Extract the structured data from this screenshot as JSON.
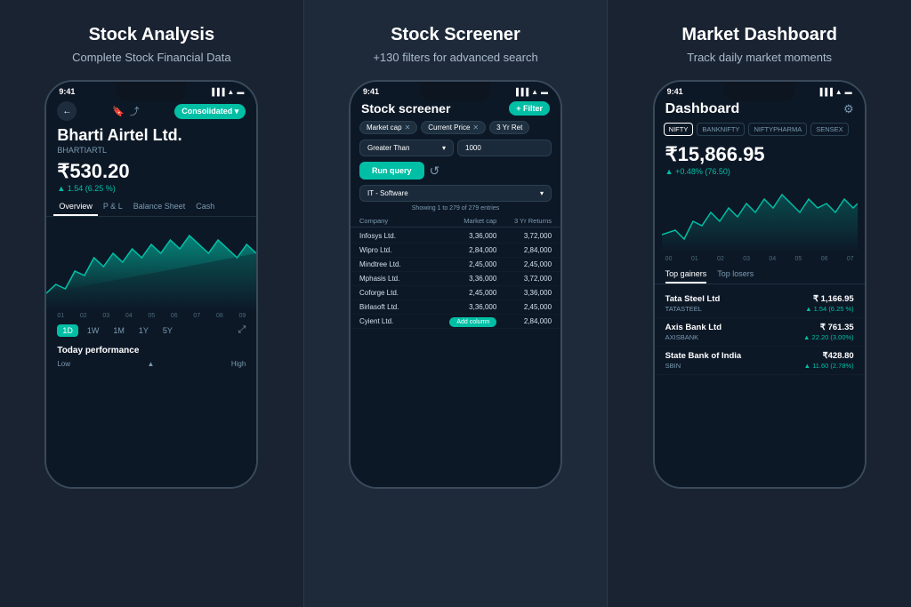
{
  "panel1": {
    "title": "Stock Analysis",
    "subtitle": "Complete Stock Financial Data",
    "statusTime": "9:41",
    "header": {
      "consolidatedLabel": "Consolidated ▾"
    },
    "company": {
      "name": "Bharti Airtel Ltd.",
      "ticker": "BHARTIARTL"
    },
    "price": "₹530.20",
    "change": "▲ 1.54 (6.25 %)",
    "tabs": [
      "Overview",
      "P & L",
      "Balance Sheet",
      "Cash"
    ],
    "activeTab": "Overview",
    "timeLabels": [
      "01",
      "02",
      "03",
      "04",
      "05",
      "06",
      "07",
      "08",
      "09"
    ],
    "timeframeButtons": [
      "1D",
      "1W",
      "1M",
      "1Y",
      "5Y"
    ],
    "activeTimeframe": "1D",
    "todayPerformance": "Today performance",
    "lowLabel": "Low",
    "highLabel": "High"
  },
  "panel2": {
    "title": "Stock Screener",
    "subtitle": "+130 filters for advanced search",
    "statusTime": "9:41",
    "screenTitle": "Stock screener",
    "filterButtonLabel": "+ Filter",
    "chips": [
      {
        "label": "Market cap",
        "hasX": true
      },
      {
        "label": "Current Price",
        "hasX": true
      },
      {
        "label": "3 Yr Ret",
        "hasX": false
      }
    ],
    "filterSelect": "Greater Than",
    "filterValue": "1000",
    "runQueryLabel": "Run query",
    "sectorLabel": "IT - Software",
    "showingText": "Showing 1 to 279 of 279 entries",
    "tableHeaders": [
      "Company",
      "Market cap",
      "3 Yr Returns"
    ],
    "tableRows": [
      {
        "company": "Infosys Ltd.",
        "marketCap": "3,36,000",
        "returns": "3,72,000"
      },
      {
        "company": "Wipro Ltd.",
        "marketCap": "2,84,000",
        "returns": "2,84,000"
      },
      {
        "company": "Mindtree Ltd.",
        "marketCap": "2,45,000",
        "returns": "2,45,000"
      },
      {
        "company": "Mphasis Ltd.",
        "marketCap": "3,36,000",
        "returns": "3,72,000"
      },
      {
        "company": "Coforge Ltd.",
        "marketCap": "2,45,000",
        "returns": "3,36,000"
      },
      {
        "company": "Birlasoft Ltd.",
        "marketCap": "3,36,000",
        "returns": "2,45,000"
      },
      {
        "company": "Cyient Ltd.",
        "marketCap": "",
        "returns": "2,84,000"
      }
    ],
    "addColumnLabel": "Add column"
  },
  "panel3": {
    "title": "Market Dashboard",
    "subtitle": "Track daily market moments",
    "statusTime": "9:41",
    "dashTitle": "Dashboard",
    "indexTabs": [
      "NIFTY",
      "BANKNIFTY",
      "NIFTYPHARMA",
      "SENSEX"
    ],
    "activeIndex": "NIFTY",
    "price": "₹15,866.95",
    "change": "▲ +0.48% (76.50)",
    "timeLabels": [
      "00",
      "01",
      "02",
      "03",
      "04",
      "05",
      "06",
      "07"
    ],
    "gainerTabs": [
      "Top gainers",
      "Top losers"
    ],
    "activeGainerTab": "Top gainers",
    "stocks": [
      {
        "name": "Tata Steel Ltd",
        "ticker": "TATASTEEL",
        "price": "₹ 1,166.95",
        "change": "▲ 1.54 (6.25 %)",
        "positive": true
      },
      {
        "name": "Axis Bank Ltd",
        "ticker": "AXISBANK",
        "price": "₹ 761.35",
        "change": "▲ 22.20 (3.00%)",
        "positive": true
      },
      {
        "name": "State Bank of India",
        "ticker": "SBIN",
        "price": "₹428.80",
        "change": "▲ 11.60 (2.78%)",
        "positive": true
      }
    ]
  }
}
